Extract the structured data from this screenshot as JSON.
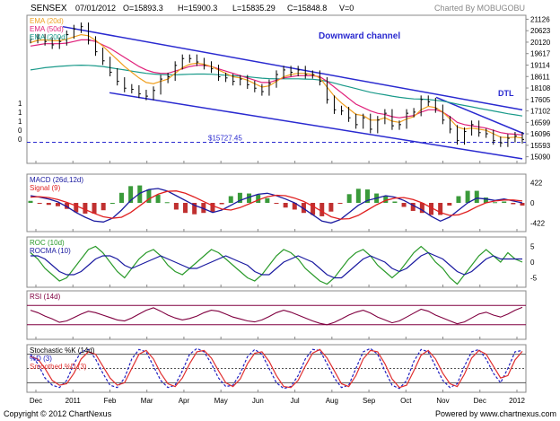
{
  "header": {
    "symbol": "SENSEX",
    "date": "07/01/2012",
    "open": "O=15893.3",
    "high": "H=15900.3",
    "low": "L=15835.29",
    "close": "C=15848.8",
    "volume": "V=0",
    "credit": "Charted By MOBUGOBU"
  },
  "footer": {
    "copyright": "Copyright © 2012 ChartNexus",
    "powered": "Powered by www.chartnexus.com"
  },
  "colors": {
    "price": "#000000",
    "ema20": "#f0a020",
    "ema50": "#e0207a",
    "ema200": "#1a9a8a",
    "channel": "#2a2ad0",
    "macd": "#1a1aa0",
    "signal": "#e02020",
    "hist_up": "#3a9a3a",
    "hist_down": "#c03030",
    "roc": "#2a9a2a",
    "rocma": "#1a1aa0",
    "rsi": "#800040",
    "stochK": "#2020c0",
    "stochD": "#e03030"
  },
  "chart_data": [
    {
      "type": "line",
      "title": "SENSEX",
      "legend": [
        "EMA (20d)",
        "EMA (50d)",
        "EMA (200d)"
      ],
      "x_ticks": [
        "Dec",
        "2011",
        "Feb",
        "Mar",
        "Apr",
        "May",
        "Jun",
        "Jul",
        "Aug",
        "Sep",
        "Oct",
        "Nov",
        "Dec",
        "2012"
      ],
      "y_ticks": [
        21126,
        20623,
        20120,
        19617,
        19114,
        18611,
        18108,
        17605,
        17102,
        16599,
        16096,
        15593,
        15090
      ],
      "left_ticks": [
        "1",
        "1",
        "1",
        "0",
        "0"
      ],
      "ylim": [
        14800,
        21300
      ],
      "annotations": [
        "Downward channel",
        "DTL",
        "15727.45"
      ],
      "support_level": 15727.45,
      "close": [
        20250,
        20300,
        20150,
        20000,
        20150,
        20450,
        20700,
        20800,
        20200,
        19700,
        19300,
        18800,
        18400,
        18100,
        18050,
        17850,
        17750,
        18000,
        18500,
        18600,
        19100,
        19400,
        19400,
        19250,
        19100,
        18950,
        18600,
        18550,
        18400,
        18500,
        18250,
        18100,
        17950,
        18300,
        18700,
        18900,
        18800,
        18900,
        18700,
        18700,
        18400,
        17600,
        17150,
        17100,
        16800,
        16500,
        16800,
        16300,
        16700,
        17000,
        16450,
        16500,
        17000,
        17050,
        17600,
        17500,
        17200,
        16700,
        16300,
        15800,
        16200,
        16500,
        16150,
        16100,
        15800,
        15700,
        15900,
        16000,
        15850
      ],
      "ema20": [
        20100,
        20200,
        20220,
        20180,
        20180,
        20250,
        20350,
        20450,
        20400,
        20200,
        19950,
        19650,
        19350,
        19050,
        18800,
        18550,
        18350,
        18300,
        18400,
        18500,
        18750,
        19000,
        19150,
        19200,
        19150,
        19050,
        18900,
        18750,
        18600,
        18550,
        18450,
        18300,
        18150,
        18200,
        18400,
        18600,
        18700,
        18750,
        18750,
        18700,
        18550,
        18150,
        17750,
        17450,
        17200,
        16950,
        16900,
        16700,
        16700,
        16800,
        16650,
        16600,
        16750,
        16850,
        17150,
        17300,
        17250,
        17050,
        16750,
        16400,
        16300,
        16350,
        16300,
        16250,
        16100,
        15950,
        15930,
        15950,
        15920
      ],
      "ema50": [
        19950,
        20000,
        20050,
        20050,
        20050,
        20080,
        20150,
        20220,
        20220,
        20150,
        20000,
        19850,
        19650,
        19450,
        19250,
        19050,
        18900,
        18800,
        18750,
        18750,
        18850,
        18950,
        19050,
        19100,
        19100,
        19050,
        18950,
        18850,
        18750,
        18650,
        18550,
        18450,
        18350,
        18350,
        18450,
        18550,
        18600,
        18650,
        18650,
        18650,
        18600,
        18400,
        18150,
        17900,
        17650,
        17400,
        17250,
        17100,
        17000,
        16950,
        16850,
        16800,
        16850,
        16900,
        17050,
        17150,
        17150,
        17050,
        16850,
        16600,
        16500,
        16450,
        16400,
        16350,
        16250,
        16150,
        16100,
        16080,
        16050
      ],
      "ema200": [
        18900,
        18950,
        19000,
        19030,
        19060,
        19080,
        19100,
        19110,
        19100,
        19080,
        19050,
        19000,
        18950,
        18900,
        18850,
        18800,
        18750,
        18720,
        18700,
        18690,
        18690,
        18700,
        18710,
        18720,
        18720,
        18710,
        18690,
        18670,
        18650,
        18630,
        18600,
        18570,
        18540,
        18520,
        18510,
        18510,
        18510,
        18510,
        18500,
        18490,
        18460,
        18400,
        18320,
        18240,
        18160,
        18080,
        18000,
        17920,
        17860,
        17810,
        17750,
        17700,
        17660,
        17630,
        17620,
        17600,
        17570,
        17530,
        17470,
        17400,
        17340,
        17280,
        17220,
        17160,
        17100,
        17040,
        16980,
        16930,
        16880
      ]
    },
    {
      "type": "bar",
      "title": "MACD (26d,12d)",
      "legend": [
        "MACD (26d,12d)",
        "Signal (9)"
      ],
      "y_ticks": [
        422,
        0,
        -422
      ],
      "ylim": [
        -600,
        600
      ],
      "macd": [
        150,
        120,
        80,
        20,
        -80,
        -200,
        -300,
        -380,
        -400,
        -320,
        -150,
        50,
        200,
        280,
        300,
        250,
        150,
        50,
        -50,
        -120,
        -200,
        -150,
        -50,
        50,
        120,
        180,
        200,
        150,
        80,
        0,
        -120,
        -250,
        -380,
        -420,
        -350,
        -200,
        -50,
        50,
        100,
        150,
        120,
        50,
        -50,
        -150,
        -280,
        -380,
        -300,
        -150,
        0,
        100,
        80,
        50,
        80,
        40,
        0
      ],
      "signal": [
        120,
        130,
        110,
        70,
        10,
        -60,
        -140,
        -220,
        -290,
        -320,
        -300,
        -200,
        -60,
        80,
        180,
        240,
        250,
        200,
        120,
        30,
        -60,
        -130,
        -150,
        -100,
        -20,
        60,
        130,
        160,
        150,
        100,
        30,
        -70,
        -180,
        -290,
        -340,
        -330,
        -260,
        -150,
        -40,
        50,
        100,
        110,
        70,
        0,
        -100,
        -200,
        -260,
        -250,
        -180,
        -80,
        0,
        40,
        60,
        60,
        40
      ]
    },
    {
      "type": "line",
      "title": "ROC (10d)",
      "legend": [
        "ROC (10d)",
        "ROCMA (10)"
      ],
      "y_ticks": [
        5,
        0,
        -5
      ],
      "ylim": [
        -8,
        8
      ],
      "roc": [
        3,
        1,
        -2,
        -4,
        -6,
        -5,
        -2,
        1,
        4,
        5,
        3,
        0,
        -3,
        -5,
        -2,
        1,
        3,
        4,
        2,
        -1,
        -3,
        -4,
        -2,
        0,
        2,
        4,
        3,
        1,
        -1,
        -3,
        -5,
        -6,
        -4,
        -1,
        2,
        4,
        3,
        1,
        -2,
        -4,
        -6,
        -7,
        -5,
        -2,
        1,
        3,
        4,
        2,
        -1,
        -3,
        -5,
        -3,
        0,
        3,
        5,
        3,
        0,
        -2,
        -5,
        -7,
        -4,
        -1,
        2,
        4,
        2,
        0,
        3,
        1,
        0
      ],
      "rocma": [
        2,
        2,
        1,
        -1,
        -3,
        -4,
        -4,
        -3,
        -1,
        1,
        2,
        2,
        1,
        -1,
        -2,
        -1,
        0,
        1,
        2,
        1,
        0,
        -1,
        -2,
        -2,
        -1,
        0,
        1,
        2,
        1,
        0,
        -1,
        -3,
        -4,
        -4,
        -2,
        0,
        1,
        2,
        1,
        0,
        -2,
        -4,
        -5,
        -5,
        -3,
        -1,
        1,
        2,
        1,
        0,
        -2,
        -3,
        -2,
        0,
        2,
        3,
        2,
        1,
        -1,
        -3,
        -4,
        -3,
        -1,
        1,
        2,
        1,
        1,
        1,
        1
      ]
    },
    {
      "type": "line",
      "title": "RSI (14d)",
      "legend": [
        "RSI (14d)"
      ],
      "ylim": [
        0,
        100
      ],
      "levels": [
        30,
        70
      ],
      "rsi": [
        60,
        55,
        48,
        42,
        35,
        38,
        45,
        52,
        58,
        55,
        50,
        45,
        40,
        38,
        44,
        52,
        60,
        65,
        58,
        50,
        44,
        40,
        43,
        48,
        55,
        60,
        58,
        52,
        46,
        42,
        38,
        36,
        40,
        47,
        55,
        60,
        56,
        50,
        44,
        38,
        33,
        30,
        35,
        42,
        50,
        56,
        60,
        54,
        46,
        40,
        34,
        38,
        46,
        54,
        62,
        58,
        50,
        44,
        38,
        32,
        36,
        44,
        52,
        56,
        50,
        46,
        52,
        60,
        66
      ]
    },
    {
      "type": "line",
      "title": "Stochastic %K (14d)",
      "legend": [
        "Stochastic %K (14d)",
        "%D (3)",
        "Smoothed %D (3)"
      ],
      "ylim": [
        0,
        100
      ],
      "levels": [
        20,
        50,
        80
      ],
      "stochK": [
        80,
        60,
        30,
        15,
        10,
        25,
        60,
        85,
        90,
        70,
        40,
        15,
        10,
        30,
        70,
        90,
        85,
        55,
        25,
        10,
        15,
        45,
        80,
        92,
        85,
        60,
        30,
        12,
        15,
        40,
        75,
        90,
        80,
        50,
        20,
        8,
        12,
        35,
        70,
        90,
        88,
        60,
        30,
        10,
        15,
        50,
        85,
        92,
        80,
        45,
        15,
        8,
        25,
        65,
        90,
        85,
        55,
        25,
        10,
        18,
        55,
        85,
        90,
        70,
        40,
        20,
        50,
        85,
        88
      ],
      "stochD": [
        75,
        70,
        50,
        25,
        15,
        18,
        40,
        70,
        85,
        80,
        55,
        30,
        15,
        20,
        50,
        80,
        88,
        70,
        40,
        18,
        12,
        30,
        60,
        85,
        88,
        72,
        45,
        20,
        12,
        28,
        60,
        82,
        85,
        65,
        35,
        12,
        10,
        25,
        55,
        82,
        90,
        72,
        45,
        18,
        12,
        35,
        70,
        88,
        85,
        60,
        28,
        10,
        15,
        45,
        78,
        88,
        70,
        40,
        18,
        12,
        38,
        72,
        88,
        80,
        55,
        30,
        35,
        68,
        86
      ]
    }
  ]
}
